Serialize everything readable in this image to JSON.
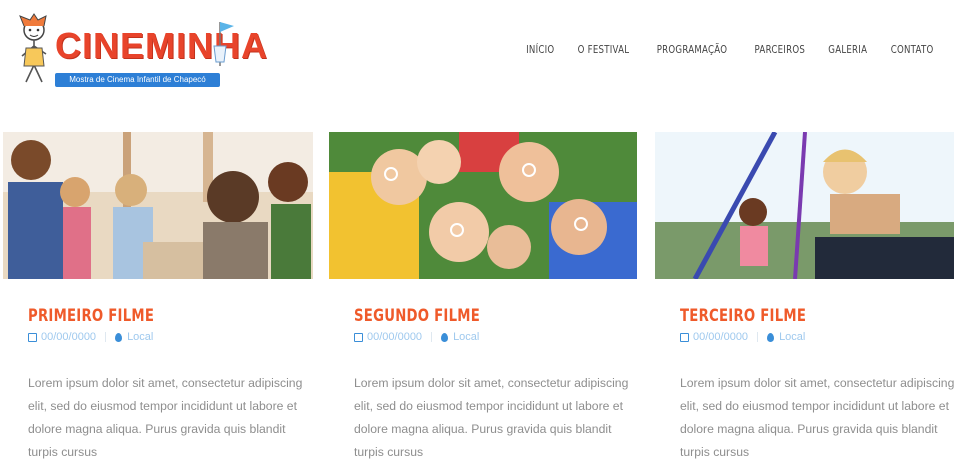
{
  "brand": {
    "name": "CINEMINHA",
    "tagline": "Mostra de Cinema Infantil de Chapecó"
  },
  "nav": {
    "items": [
      {
        "label": "INÍCIO"
      },
      {
        "label": "O FESTIVAL"
      },
      {
        "label": "PROGRAMAÇÃO"
      },
      {
        "label": "PARCEIROS"
      },
      {
        "label": "GALERIA"
      },
      {
        "label": "CONTATO"
      }
    ]
  },
  "posts": [
    {
      "title": "PRIMEIRO FILME",
      "date": "00/00/0000",
      "location": "Local",
      "excerpt": "Lorem ipsum dolor sit amet, consectetur adipiscing elit, sed do eiusmod tempor incididunt ut labore et dolore magna aliqua. Purus gravida quis blandit turpis cursus"
    },
    {
      "title": "SEGUNDO FILME",
      "date": "00/00/0000",
      "location": "Local",
      "excerpt": "Lorem ipsum dolor sit amet, consectetur adipiscing elit, sed do eiusmod tempor incididunt ut labore et dolore magna aliqua. Purus gravida quis blandit turpis cursus"
    },
    {
      "title": "TERCEIRO FILME",
      "date": "00/00/0000",
      "location": "Local",
      "excerpt": "Lorem ipsum dolor sit amet, consectetur adipiscing elit, sed do eiusmod tempor incididunt ut labore et dolore magna aliqua. Purus gravida quis blandit turpis cursus"
    }
  ],
  "colors": {
    "accent": "#ef5a2a",
    "meta": "#3a8ed8"
  }
}
